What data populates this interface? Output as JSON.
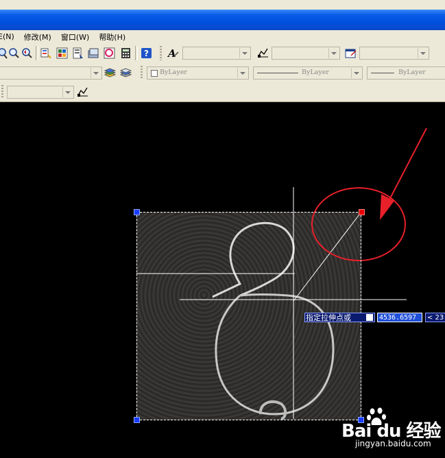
{
  "menu": {
    "items": [
      {
        "label": "E(N)"
      },
      {
        "label": "修改(M)"
      },
      {
        "label": "窗口(W)"
      },
      {
        "label": "帮助(H)"
      }
    ]
  },
  "properties": {
    "color": "ByLayer",
    "linetype": "ByLayer",
    "lineweight": "ByLayer"
  },
  "command": {
    "prompt": "指定拉伸点或",
    "value": "4536.6597",
    "angle": "< 23"
  },
  "watermark": {
    "logo_text": "Bai du 经验",
    "url": "jingyan.baidu.com"
  },
  "colors": {
    "canvas": "#000000",
    "title_bar": "#0a5ce8",
    "toolbar": "#ece9d8",
    "hot_grip": "#e60000",
    "cold_grip": "#1a3cff",
    "annotation": "#e8202a"
  }
}
